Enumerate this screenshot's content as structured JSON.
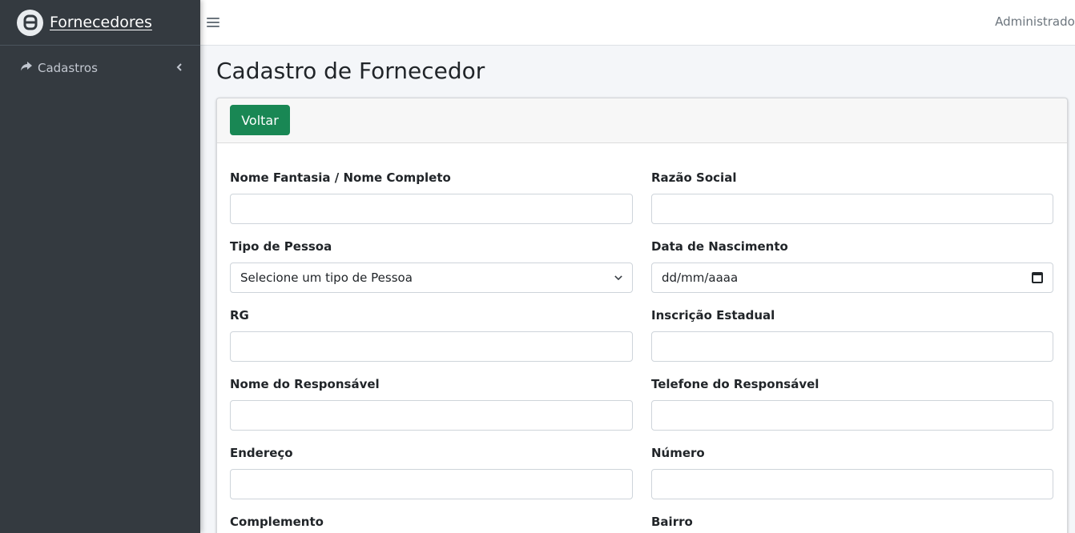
{
  "brand": {
    "name": "Fornecedores"
  },
  "sidebar": {
    "items": [
      {
        "label": "Cadastros"
      }
    ]
  },
  "topbar": {
    "user": "Administrador"
  },
  "page": {
    "title": "Cadastro de Fornecedor"
  },
  "card": {
    "back_label": "Voltar"
  },
  "form": {
    "nome_fantasia": {
      "label": "Nome Fantasia / Nome Completo",
      "value": ""
    },
    "razao_social": {
      "label": "Razão Social",
      "value": ""
    },
    "tipo_pessoa": {
      "label": "Tipo de Pessoa",
      "value": "Selecione um tipo de Pessoa"
    },
    "data_nascimento": {
      "label": "Data de Nascimento",
      "value": "dd/mm/aaaa"
    },
    "rg": {
      "label": "RG",
      "value": ""
    },
    "inscricao_estadual": {
      "label": "Inscrição Estadual",
      "value": ""
    },
    "nome_responsavel": {
      "label": "Nome do Responsável",
      "value": ""
    },
    "telefone_responsavel": {
      "label": "Telefone do Responsável",
      "value": ""
    },
    "endereco": {
      "label": "Endereço",
      "value": ""
    },
    "numero": {
      "label": "Número",
      "value": ""
    },
    "complemento": {
      "label": "Complemento"
    },
    "bairro": {
      "label": "Bairro"
    }
  }
}
